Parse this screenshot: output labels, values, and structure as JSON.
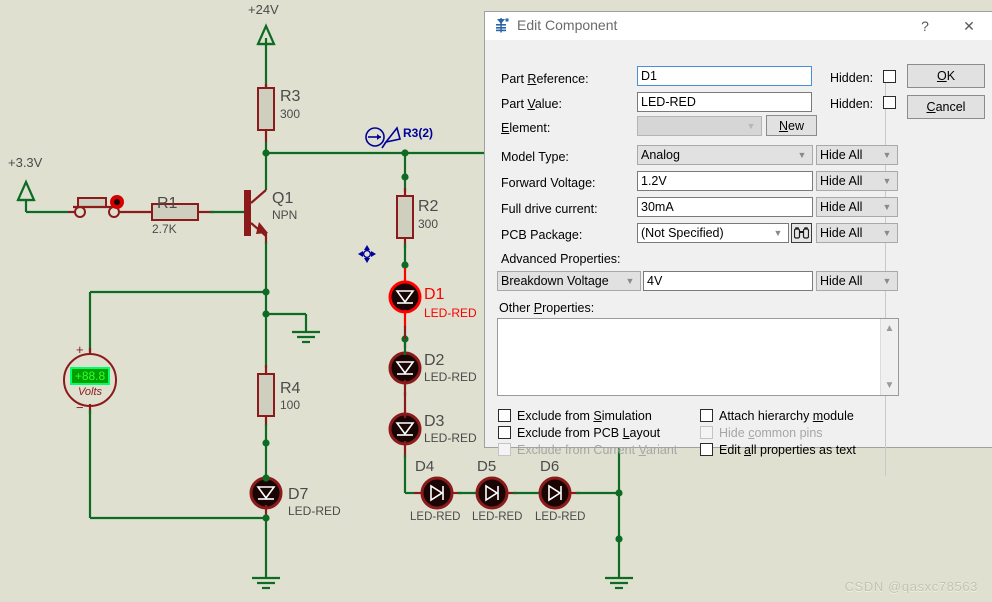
{
  "schematic": {
    "terminals": [
      {
        "name": "power-3v3",
        "label": "+3.3V"
      },
      {
        "name": "power-24v",
        "label": "+24V"
      }
    ],
    "probe": {
      "label": "R3(2)"
    },
    "meter": {
      "value": "+88.8",
      "unit": "Volts"
    },
    "components": [
      {
        "ref": "R1",
        "value": "2.7K"
      },
      {
        "ref": "R2",
        "value": "300"
      },
      {
        "ref": "R3",
        "value": "300"
      },
      {
        "ref": "R4",
        "value": "100"
      },
      {
        "ref": "Q1",
        "value": "NPN"
      },
      {
        "ref": "D1",
        "value": "LED-RED"
      },
      {
        "ref": "D2",
        "value": "LED-RED"
      },
      {
        "ref": "D3",
        "value": "LED-RED"
      },
      {
        "ref": "D4",
        "value": "LED-RED"
      },
      {
        "ref": "D5",
        "value": "LED-RED"
      },
      {
        "ref": "D6",
        "value": "LED-RED"
      },
      {
        "ref": "D7",
        "value": "LED-RED"
      }
    ],
    "colors": {
      "background": "#dfe0d0",
      "wire": "#0d6b23",
      "body": "#8b1a1a",
      "selected": "#ff0000",
      "probe": "#00009a"
    }
  },
  "watermark": "CSDN @qasxc78563",
  "dialog": {
    "title": "Edit Component",
    "titlebar": {
      "help_label": "?",
      "close_label": "✕"
    },
    "fields": {
      "part_reference": {
        "label_pre": "Part ",
        "label_key": "R",
        "label_post": "eference:",
        "value": "D1",
        "hidden_label": "Hidden:"
      },
      "part_value": {
        "label_pre": "Part ",
        "label_key": "V",
        "label_post": "alue:",
        "value": "LED-RED",
        "hidden_label": "Hidden:"
      },
      "element": {
        "label_key": "E",
        "label_post": "lement:",
        "value": "",
        "new_button": "New",
        "new_key": "N",
        "new_rest": "ew"
      },
      "model_type": {
        "label": "Model Type:",
        "value": "Analog",
        "hide": "Hide All"
      },
      "forward_voltage": {
        "label": "Forward Voltage:",
        "value": "1.2V",
        "hide": "Hide All"
      },
      "full_drive_current": {
        "label": "Full drive current:",
        "value": "30mA",
        "hide": "Hide All"
      },
      "pcb_package": {
        "label": "PCB Package:",
        "value": "(Not Specified)",
        "hide": "Hide All"
      },
      "advanced_properties": {
        "label": "Advanced Properties:",
        "selector": "Breakdown Voltage",
        "value": "4V",
        "hide": "Hide All"
      },
      "other_properties": {
        "label_pre": "Other ",
        "label_key": "P",
        "label_post": "roperties:",
        "value": ""
      }
    },
    "checkboxes": [
      {
        "name": "exclude-from-simulation",
        "pre": "Exclude from ",
        "key": "S",
        "post": "imulation",
        "checked": false,
        "disabled": false
      },
      {
        "name": "exclude-from-pcb-layout",
        "pre": "Exclude from PCB ",
        "key": "L",
        "post": "ayout",
        "checked": false,
        "disabled": false
      },
      {
        "name": "exclude-from-current-variant",
        "pre": "Exclude from Current ",
        "key": "V",
        "post": "ariant",
        "checked": false,
        "disabled": true
      },
      {
        "name": "attach-hierarchy-module",
        "pre": "Attach hierarchy ",
        "key": "m",
        "post": "odule",
        "checked": false,
        "disabled": false
      },
      {
        "name": "hide-common-pins",
        "pre": "Hide ",
        "key": "c",
        "post": "ommon pins",
        "checked": false,
        "disabled": true
      },
      {
        "name": "edit-all-properties-as-text",
        "pre": "Edit ",
        "key": "a",
        "post": "ll properties as text",
        "checked": false,
        "disabled": false
      }
    ],
    "buttons": {
      "ok": {
        "key": "O",
        "rest": "K"
      },
      "cancel": {
        "pre": "",
        "key": "C",
        "rest": "ancel"
      }
    }
  }
}
